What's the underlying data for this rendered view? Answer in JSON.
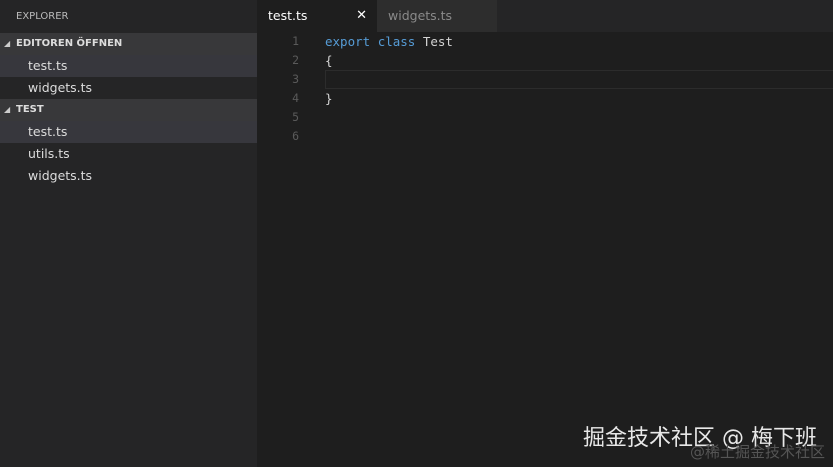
{
  "sidebar": {
    "title": "EXPLORER",
    "open_editors": {
      "label": "EDITOREN ÖFFNEN",
      "items": [
        "test.ts",
        "widgets.ts"
      ]
    },
    "folder": {
      "label": "TEST",
      "items": [
        "test.ts",
        "utils.ts",
        "widgets.ts"
      ]
    }
  },
  "tabs": [
    {
      "label": "test.ts",
      "close": "✕"
    },
    {
      "label": "widgets.ts"
    }
  ],
  "editor": {
    "lines": [
      {
        "n": "1",
        "kw1": "export",
        "kw2": "class",
        "rest": "Test"
      },
      {
        "n": "2",
        "text": "{"
      },
      {
        "n": "3",
        "text": ""
      },
      {
        "n": "4",
        "text": "}"
      },
      {
        "n": "5",
        "text": ""
      },
      {
        "n": "6",
        "text": ""
      }
    ]
  },
  "watermark": {
    "main": "掘金技术社区 @ 梅下班",
    "sub": "@稀土掘金技术社区"
  }
}
